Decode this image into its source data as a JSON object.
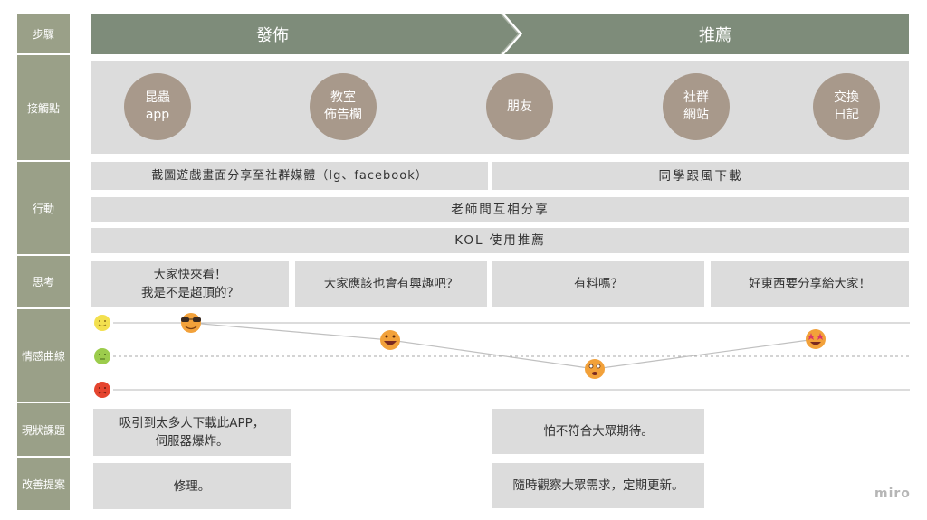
{
  "rows": {
    "steps": "步驟",
    "touchpoints": "接觸點",
    "actions": "行動",
    "thinking": "思考",
    "emotion": "情感曲線",
    "problems": "現狀課題",
    "proposals": "改善提案"
  },
  "phases": [
    "發佈",
    "推薦"
  ],
  "touchpoints": [
    {
      "label": "昆蟲\napp"
    },
    {
      "label": "教室\n佈告欄"
    },
    {
      "label": "朋友"
    },
    {
      "label": "社群\n網站"
    },
    {
      "label": "交換\n日記"
    }
  ],
  "actions": {
    "share_screenshot": "截圖遊戲畫面分享至社群媒體（Ig、facebook）",
    "follow_download": "同學跟風下載",
    "teacher_share": "老師間互相分享",
    "kol": "KOL 使用推薦"
  },
  "thoughts": [
    "大家快來看！\n我是不是超頂的？",
    "大家應該也會有興趣吧？",
    "有料嗎？",
    "好東西要分享給大家！"
  ],
  "emotion": {
    "levels": [
      "positive",
      "neutral",
      "negative"
    ],
    "points": [
      1.0,
      0.5,
      0.0,
      0.5
    ],
    "emojis": [
      "sunglasses-face",
      "grinning-face",
      "worried-face",
      "star-struck-face"
    ],
    "colors": {
      "positive": "#f3e04f",
      "neutral": "#9ccc4c",
      "negative": "#e5452f",
      "emoji": "#f2a13a"
    }
  },
  "problems": [
    "吸引到太多人下載此APP，\n伺服器爆炸。",
    "怕不符合大眾期待。"
  ],
  "proposals": [
    "修理。",
    "隨時觀察大眾需求，定期更新。"
  ],
  "watermark": "miro",
  "colors": {
    "sidebar": "#9aa088",
    "phase": "#7e8c7a",
    "box": "#dcdcdc",
    "touchpoint": "#a8998b"
  }
}
